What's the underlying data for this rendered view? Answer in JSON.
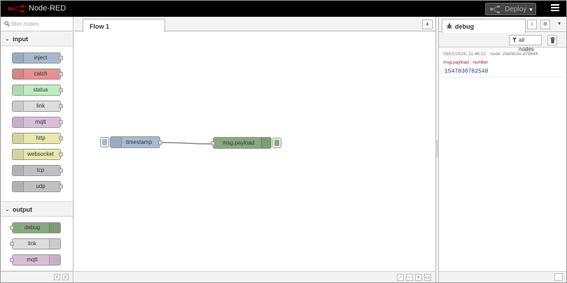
{
  "app": {
    "title": "Node-RED"
  },
  "header": {
    "deploy_label": "Deploy"
  },
  "palette": {
    "filter_placeholder": "filter nodes",
    "categories": [
      {
        "label": "input",
        "nodes": [
          {
            "label": "inject",
            "color": "#a6bbcf"
          },
          {
            "label": "catch",
            "color": "#e49191"
          },
          {
            "label": "status",
            "color": "#c0edc0"
          },
          {
            "label": "link",
            "color": "#dddddd"
          },
          {
            "label": "mqtt",
            "color": "#d8bfd8"
          },
          {
            "label": "http",
            "color": "#e7e7ae"
          },
          {
            "label": "websocket",
            "color": "#e7e7ae"
          },
          {
            "label": "tcp",
            "color": "#c0c0c0"
          },
          {
            "label": "udp",
            "color": "#c0c0c0"
          }
        ]
      },
      {
        "label": "output",
        "nodes": [
          {
            "label": "debug",
            "color": "#87a980"
          },
          {
            "label": "link",
            "color": "#dddddd"
          },
          {
            "label": "mqtt",
            "color": "#d8bfd8"
          }
        ]
      }
    ]
  },
  "workspace": {
    "tabs": [
      {
        "label": "Flow 1"
      }
    ],
    "nodes": [
      {
        "label": "timestamp",
        "color": "#a6bbcf"
      },
      {
        "label": "msg.payload",
        "color": "#87a980"
      }
    ]
  },
  "sidebar": {
    "tab_label": "debug",
    "filter_label": "all nodes",
    "messages": [
      {
        "timestamp": "09/01/2019, 11:46:22",
        "node": "node: 24ef8c0e.d79844",
        "topic": "msg.payload : number",
        "value": "1547030782548"
      }
    ]
  }
}
